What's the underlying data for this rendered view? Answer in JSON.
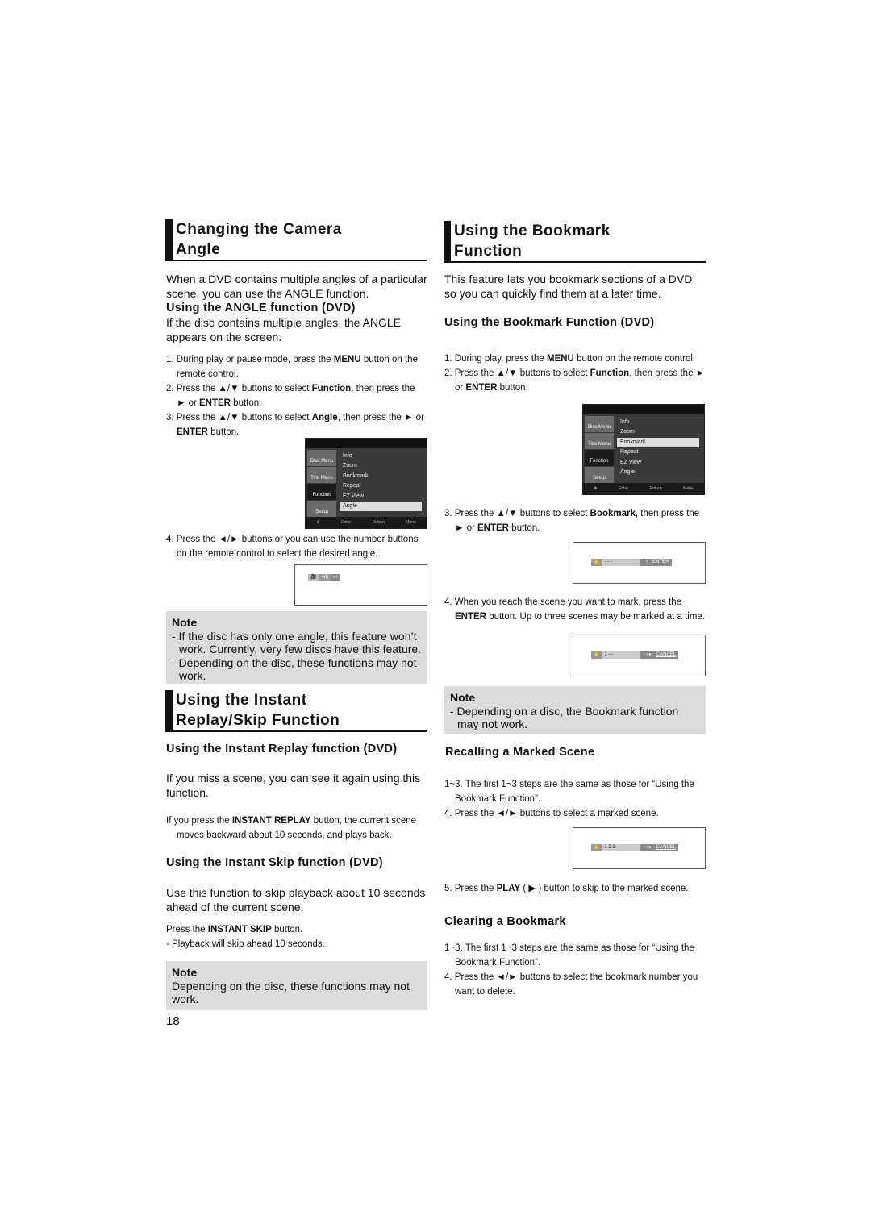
{
  "left": {
    "camera": {
      "title_1": "Changing the Camera",
      "title_2": "Angle",
      "intro": "When a DVD contains multiple angles of a particular scene, you can use the ANGLE function.",
      "sub": "Using the ANGLE function (DVD)",
      "sub_text": "If the disc contains multiple angles, the ANGLE appears on the screen.",
      "steps": [
        [
          {
            "t": "1. During play or pause mode, press the "
          },
          {
            "t": "MENU",
            "b": 1
          },
          {
            "t": " button on the remote control."
          }
        ],
        [
          {
            "t": "2. Press the ▲/▼ buttons to select "
          },
          {
            "t": "Function",
            "b": 1
          },
          {
            "t": ", then press the ► or "
          },
          {
            "t": "ENTER",
            "b": 1
          },
          {
            "t": "  button."
          }
        ],
        [
          {
            "t": "3. Press the ▲/▼ buttons to select "
          },
          {
            "t": "Angle",
            "b": 1
          },
          {
            "t": ", then press the ► or "
          },
          {
            "t": "ENTER",
            "b": 1
          },
          {
            "t": " button."
          }
        ]
      ],
      "step4": [
        [
          {
            "t": "4. Press the ◄/► buttons or you can use the number buttons on the remote control to select the desired angle."
          }
        ]
      ],
      "angle_osd": "4/6",
      "note_title": "Note",
      "notes": [
        "- If the disc has only one angle, this feature won’t work. Currently, very few discs have this feature.",
        "- Depending on the disc, these functions may not work."
      ]
    },
    "replay": {
      "title_1": "Using the Instant",
      "title_2": "Replay/Skip Function",
      "sub1": "Using the Instant Replay function (DVD)",
      "sub1_text": "If you miss a scene, you can see it again using this function.",
      "replay_steps": [
        [
          {
            "t": "If you press the "
          },
          {
            "t": "INSTANT REPLAY",
            "b": 1
          },
          {
            "t": " button, the current scene moves backward about 10 seconds, and plays back."
          }
        ]
      ],
      "sub2": "Using the Instant Skip function (DVD)",
      "sub2_text": "Use this function to skip playback about 10 seconds ahead of the current scene.",
      "skip_steps": [
        [
          {
            "t": "Press the "
          },
          {
            "t": "INSTANT SKIP",
            "b": 1
          },
          {
            "t": " button."
          }
        ],
        [
          {
            "t": "- Playback will skip ahead 10 seconds."
          }
        ]
      ],
      "note_title": "Note",
      "note": "Depending on the disc, these functions may not work."
    },
    "page_number": "18"
  },
  "menu": {
    "side": [
      "Disc Menu",
      "Title Menu",
      "Function",
      "Setup"
    ],
    "items": [
      "Info",
      "Zoom",
      "Bookmark",
      "Repeat",
      "EZ View",
      "Angle"
    ],
    "footer": [
      "Enter",
      "Return",
      "Menu"
    ]
  },
  "right": {
    "title_1": "Using the Bookmark",
    "title_2": "Function",
    "intro": "This feature lets you bookmark sections of a DVD so you can quickly find them at a later time.",
    "sub": "Using the Bookmark Function (DVD)",
    "steps12": [
      [
        {
          "t": "1. During play, press the "
        },
        {
          "t": "MENU",
          "b": 1
        },
        {
          "t": " button on the remote control."
        }
      ],
      [
        {
          "t": "2. Press the ▲/▼ buttons to select "
        },
        {
          "t": "Function",
          "b": 1
        },
        {
          "t": ", then  press the ► or "
        },
        {
          "t": "ENTER",
          "b": 1
        },
        {
          "t": " button."
        }
      ]
    ],
    "step3": [
      [
        {
          "t": "3. Press the ▲/▼ buttons to select "
        },
        {
          "t": "Bookmark",
          "b": 1
        },
        {
          "t": ", then press the ► or "
        },
        {
          "t": "ENTER",
          "b": 1
        },
        {
          "t": " button."
        }
      ]
    ],
    "step4": [
      [
        {
          "t": "4. When you reach the scene you want to mark, press the "
        },
        {
          "t": "ENTER",
          "b": 1
        },
        {
          "t": " button. Up to three scenes may be marked at a time."
        }
      ]
    ],
    "osd1": {
      "slots": "-  -  -",
      "nav": "‹ ›",
      "btn": "ENTER"
    },
    "osd2": {
      "slots": "1  -  -",
      "nav": "‹ › ▸",
      "btn": "CANCEL"
    },
    "osd3": {
      "slots": "1  2  3",
      "nav": "‹ › ▸",
      "btn": "CANCEL"
    },
    "note_title": "Note",
    "note": "-  Depending on a disc, the Bookmark function may not work.",
    "recall": {
      "title": "Recalling a Marked Scene",
      "steps": [
        [
          {
            "t": "1~3. The first 1~3 steps are the same as those for “Using the Bookmark Function”."
          }
        ],
        [
          {
            "t": "4.  Press the ◄/► buttons to select a marked scene."
          }
        ]
      ],
      "step5": [
        [
          {
            "t": "5. Press the "
          },
          {
            "t": "PLAY",
            "b": 1
          },
          {
            "t": " ( ▶ ) button to skip to the marked scene."
          }
        ]
      ]
    },
    "clear": {
      "title": "Clearing a Bookmark",
      "steps": [
        [
          {
            "t": "1~3. The first 1~3 steps are the same as those for  “Using the Bookmark Function”."
          }
        ],
        [
          {
            "t": "4. Press the ◄/► buttons to select the bookmark number you want to delete."
          }
        ]
      ]
    }
  }
}
